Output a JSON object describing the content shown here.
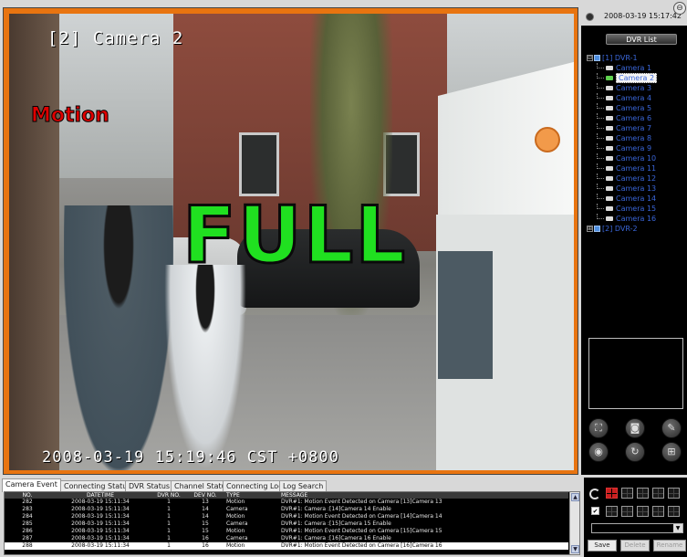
{
  "video": {
    "channel_title": "[2] Camera 2",
    "motion_label": "Motion",
    "full_label": "FULL",
    "timestamp": "2008-03-19 15:19:46 CST +0800"
  },
  "right_panel": {
    "clock": "2008-03-19 15:17:42",
    "dvr_list_label": "DVR List",
    "tree": [
      {
        "kind": "dvr",
        "expander": "⊟",
        "label": "[1] DVR-1"
      },
      {
        "kind": "cam",
        "label": "Camera 1"
      },
      {
        "kind": "cam",
        "label": "Camera 2",
        "selected": true
      },
      {
        "kind": "cam",
        "label": "Camera 3"
      },
      {
        "kind": "cam",
        "label": "Camera 4"
      },
      {
        "kind": "cam",
        "label": "Camera 5"
      },
      {
        "kind": "cam",
        "label": "Camera 6"
      },
      {
        "kind": "cam",
        "label": "Camera 7"
      },
      {
        "kind": "cam",
        "label": "Camera 8"
      },
      {
        "kind": "cam",
        "label": "Camera 9"
      },
      {
        "kind": "cam",
        "label": "Camera 10"
      },
      {
        "kind": "cam",
        "label": "Camera 11"
      },
      {
        "kind": "cam",
        "label": "Camera 12"
      },
      {
        "kind": "cam",
        "label": "Camera 13"
      },
      {
        "kind": "cam",
        "label": "Camera 14"
      },
      {
        "kind": "cam",
        "label": "Camera 15"
      },
      {
        "kind": "cam",
        "label": "Camera 16"
      },
      {
        "kind": "dvr",
        "expander": "⊞",
        "label": "[2] DVR-2"
      }
    ],
    "controls": [
      {
        "name": "fullscreen-icon",
        "glyph": "⛶"
      },
      {
        "name": "snapshot-icon",
        "glyph": "◙"
      },
      {
        "name": "wrench-icon",
        "glyph": "✎"
      },
      {
        "name": "globe-icon",
        "glyph": "◉"
      },
      {
        "name": "refresh-icon",
        "glyph": "↻"
      },
      {
        "name": "layout-icon",
        "glyph": "⊞"
      }
    ]
  },
  "tabs": [
    "Camera Event",
    "Connecting Status",
    "DVR Status",
    "Channel Status",
    "Connecting Log",
    "Log Search"
  ],
  "log": {
    "columns": [
      "NO.",
      "DATETIME",
      "DVR NO.",
      "DEV NO.",
      "TYPE",
      "MESSAGE"
    ],
    "rows": [
      [
        "282",
        "2008-03-19 15:11:34",
        "1",
        "13",
        "Motion",
        "DVR#1: Motion Event Detected on Camera [13]Camera 13"
      ],
      [
        "283",
        "2008-03-19 15:11:34",
        "1",
        "14",
        "Camera",
        "DVR#1: Camera :[14]Camera 14 Enable"
      ],
      [
        "284",
        "2008-03-19 15:11:34",
        "1",
        "14",
        "Motion",
        "DVR#1: Motion Event Detected on Camera [14]Camera 14"
      ],
      [
        "285",
        "2008-03-19 15:11:34",
        "1",
        "15",
        "Camera",
        "DVR#1: Camera :[15]Camera 15 Enable"
      ],
      [
        "286",
        "2008-03-19 15:11:34",
        "1",
        "15",
        "Motion",
        "DVR#1: Motion Event Detected on Camera [15]Camera 15"
      ],
      [
        "287",
        "2008-03-19 15:11:34",
        "1",
        "16",
        "Camera",
        "DVR#1: Camera :[16]Camera 16 Enable"
      ],
      [
        "288",
        "2008-03-19 15:11:34",
        "1",
        "16",
        "Motion",
        "DVR#1: Motion Event Detected on Camera [16]Camera 16"
      ]
    ],
    "selected_row": 6
  },
  "bottom_right": {
    "save_label": "Save",
    "delete_label": "Delete",
    "rename_label": "Rename"
  },
  "colors": {
    "video_border": "#e87410",
    "full_text": "#20e020",
    "motion_text": "#e00000",
    "tree_text": "#3a66d8"
  }
}
